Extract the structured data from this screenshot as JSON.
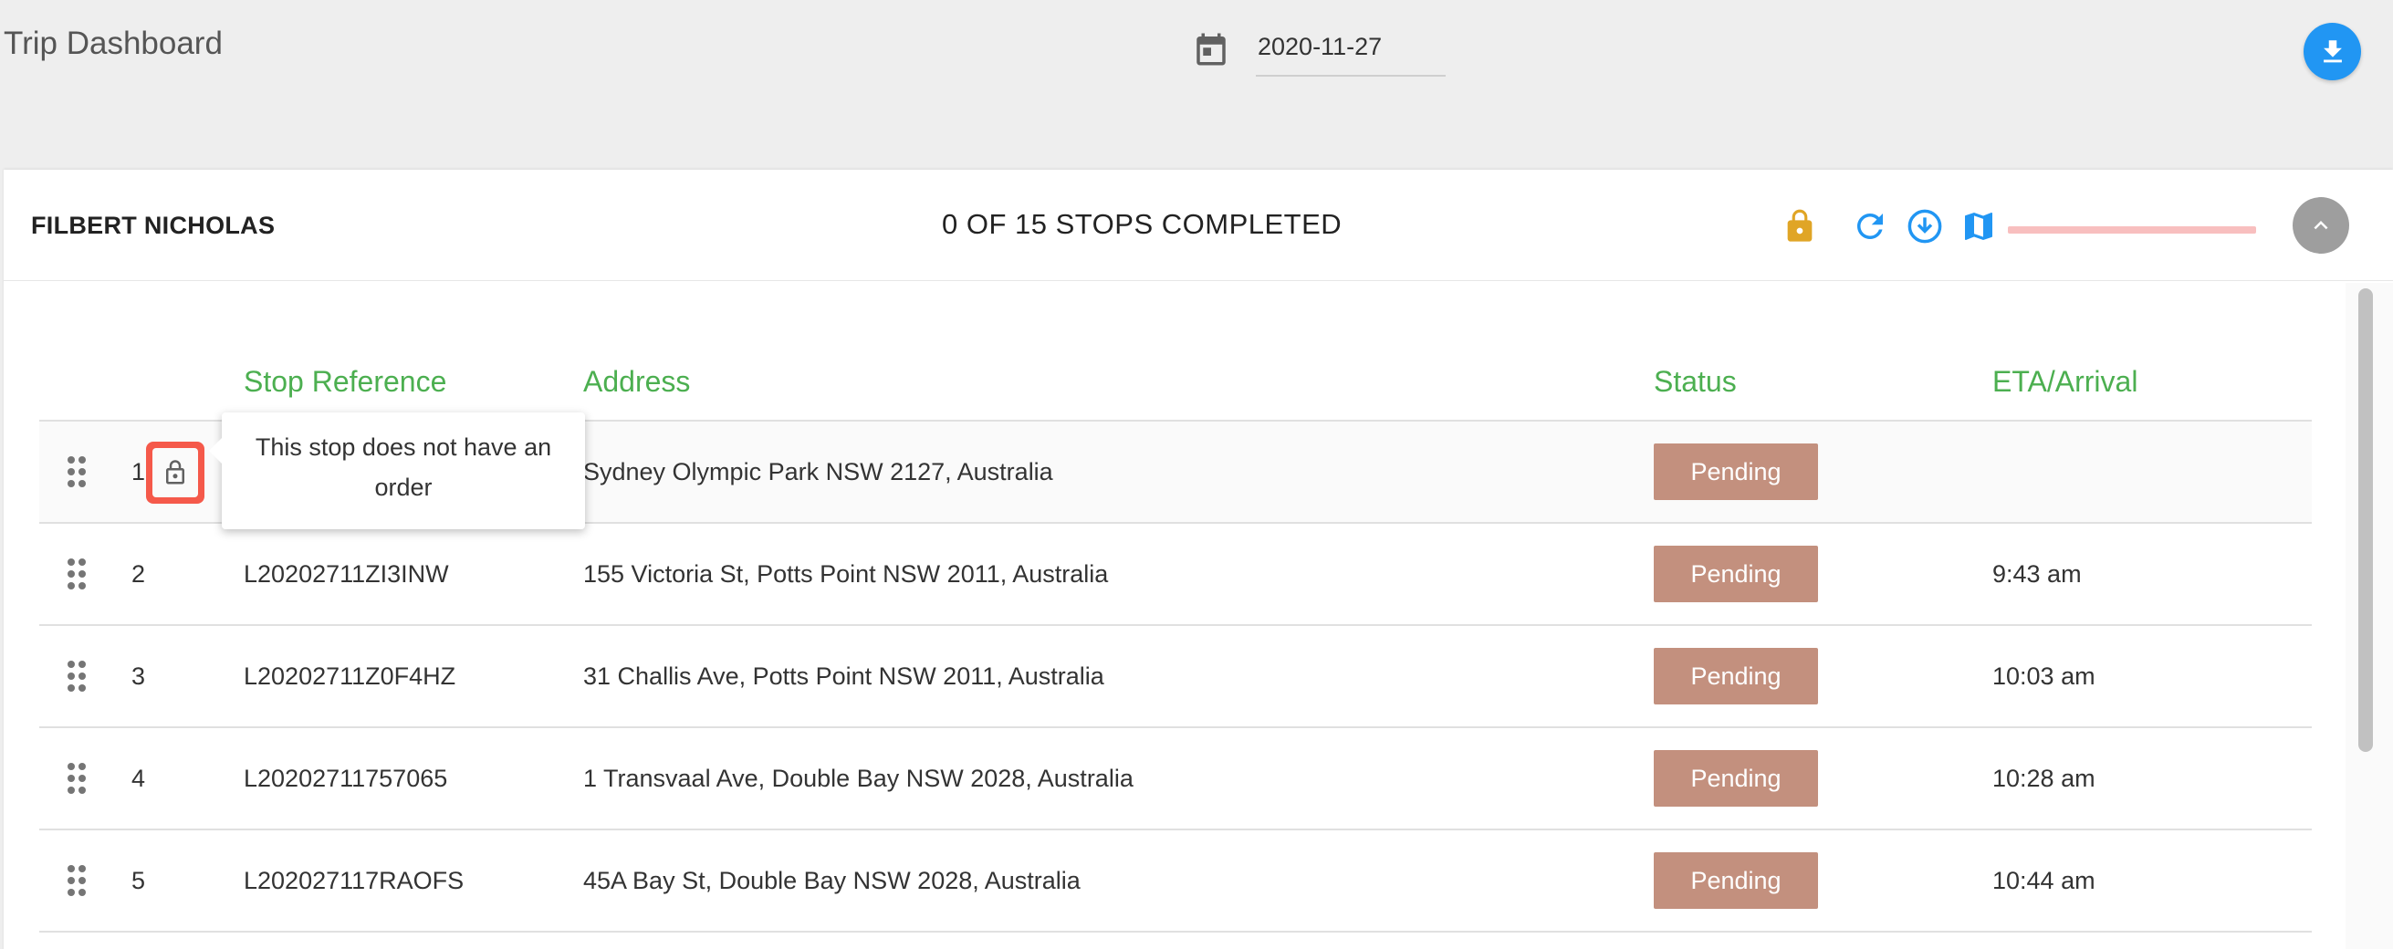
{
  "header": {
    "title": "Trip Dashboard",
    "date": "2020-11-27",
    "download_icon": "download-icon",
    "calendar_icon": "calendar-icon"
  },
  "trip": {
    "driver_name": "FILBERT NICHOLAS",
    "stops_summary": "0 OF 15 STOPS COMPLETED",
    "progress_percent": 0,
    "icons": [
      "lock-icon",
      "refresh-icon",
      "download-circle-icon",
      "map-icon",
      "chevron-up-icon"
    ]
  },
  "table": {
    "headers": {
      "stop_reference": "Stop Reference",
      "address": "Address",
      "status": "Status",
      "eta": "ETA/Arrival"
    },
    "rows": [
      {
        "num": "1",
        "ref": "",
        "address": "Sydney Olympic Park NSW 2127, Australia",
        "status": "Pending",
        "eta": ""
      },
      {
        "num": "2",
        "ref": "L20202711ZI3INW",
        "address": "155 Victoria St, Potts Point NSW 2011, Australia",
        "status": "Pending",
        "eta": "9:43 am"
      },
      {
        "num": "3",
        "ref": "L20202711Z0F4HZ",
        "address": "31 Challis Ave, Potts Point NSW 2011, Australia",
        "status": "Pending",
        "eta": "10:03 am"
      },
      {
        "num": "4",
        "ref": "L20202711757065",
        "address": "1 Transvaal Ave, Double Bay NSW 2028, Australia",
        "status": "Pending",
        "eta": "10:28 am"
      },
      {
        "num": "5",
        "ref": "L202027117RAOFS",
        "address": "45A Bay St, Double Bay NSW 2028, Australia",
        "status": "Pending",
        "eta": "10:44 am"
      }
    ]
  },
  "tooltip": {
    "text": "This stop does not have an order"
  },
  "colors": {
    "accent_blue": "#2196f3",
    "header_green": "#4caf50",
    "pending_badge": "#c3907e",
    "lock_gold": "#e0a526",
    "highlight_red": "#f5594a",
    "progress_track": "#f8bfbf"
  }
}
